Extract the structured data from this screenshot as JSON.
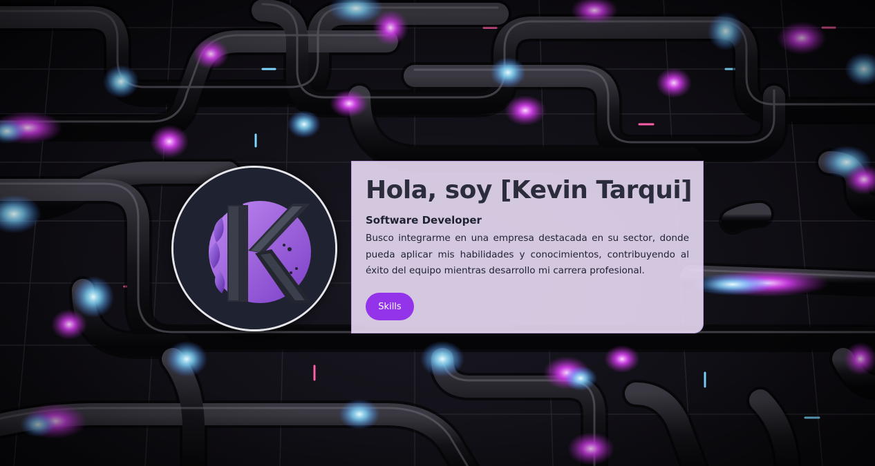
{
  "hero": {
    "title": "Hola, soy [Kevin Tarqui]",
    "subtitle": "Software Developer",
    "description": "Busco integrarme en una empresa destacada en su sector, donde pueda aplicar mis habilidades y conocimientos, contribuyendo al éxito del equipo mientras desarrollo mi carrera profesional.",
    "skills_button_label": "Skills"
  },
  "avatar": {
    "icon": "k-monogram-logo"
  },
  "background": {
    "icon": "neon-pipes-background"
  },
  "colors": {
    "accent": "#9333ea",
    "card_background": "#e9dcf5",
    "title_text": "#2b2d3c",
    "neon_magenta": "#e040fb",
    "neon_cyan": "#7fd8ff"
  }
}
